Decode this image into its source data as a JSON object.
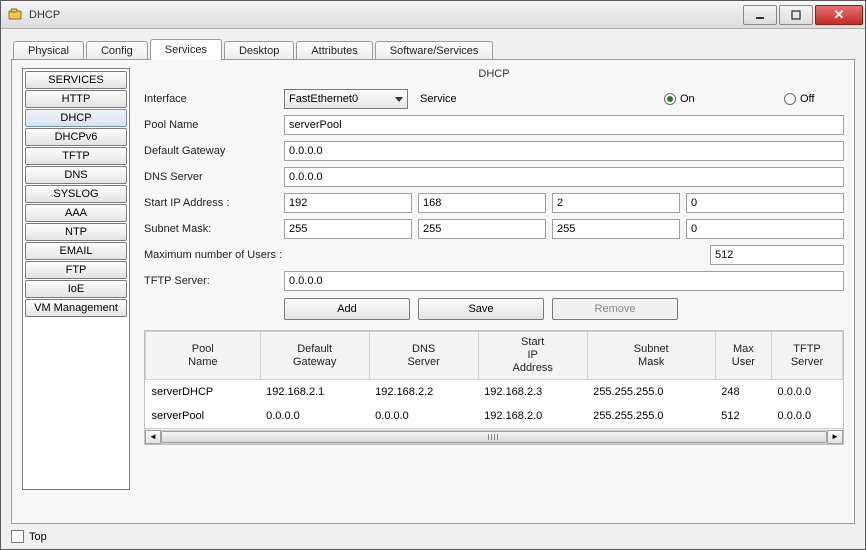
{
  "window": {
    "title": "DHCP"
  },
  "tabs": [
    "Physical",
    "Config",
    "Services",
    "Desktop",
    "Attributes",
    "Software/Services"
  ],
  "active_tab_index": 2,
  "sidebar": {
    "items": [
      "SERVICES",
      "HTTP",
      "DHCP",
      "DHCPv6",
      "TFTP",
      "DNS",
      "SYSLOG",
      "AAA",
      "NTP",
      "EMAIL",
      "FTP",
      "IoE",
      "VM Management"
    ],
    "selected_index": 2
  },
  "pane": {
    "title": "DHCP",
    "labels": {
      "interface": "Interface",
      "service": "Service",
      "on": "On",
      "off": "Off",
      "pool_name": "Pool Name",
      "default_gateway": "Default Gateway",
      "dns_server": "DNS Server",
      "start_ip": "Start IP Address :",
      "subnet_mask": "Subnet Mask:",
      "max_users": "Maximum number of Users :",
      "tftp_server": "TFTP Server:"
    },
    "interface_value": "FastEthernet0",
    "service_on": true,
    "values": {
      "pool_name": "serverPool",
      "default_gateway": "0.0.0.0",
      "dns_server": "0.0.0.0",
      "start_ip": [
        "192",
        "168",
        "2",
        "0"
      ],
      "subnet_mask": [
        "255",
        "255",
        "255",
        "0"
      ],
      "max_users": "512",
      "tftp_server": "0.0.0.0"
    },
    "buttons": {
      "add": "Add",
      "save": "Save",
      "remove": "Remove"
    },
    "grid": {
      "headers": [
        "Pool\nName",
        "Default\nGateway",
        "DNS\nServer",
        "Start\nIP\nAddress",
        "Subnet\nMask",
        "Max\nUser",
        "TFTP\nServer"
      ],
      "rows": [
        [
          "serverDHCP",
          "192.168.2.1",
          "192.168.2.2",
          "192.168.2.3",
          "255.255.255.0",
          "248",
          "0.0.0.0"
        ],
        [
          "serverPool",
          "0.0.0.0",
          "0.0.0.0",
          "192.168.2.0",
          "255.255.255.0",
          "512",
          "0.0.0.0"
        ]
      ]
    }
  },
  "footer": {
    "top_label": "Top",
    "top_checked": false
  }
}
